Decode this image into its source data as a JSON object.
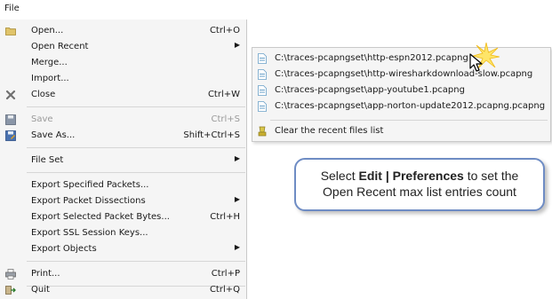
{
  "menubar": {
    "file_title": "File"
  },
  "file_menu": {
    "items": [
      {
        "label": "Open...",
        "shortcut": "Ctrl+O"
      },
      {
        "label": "Open Recent"
      },
      {
        "label": "Merge..."
      },
      {
        "label": "Import..."
      },
      {
        "label": "Close",
        "shortcut": "Ctrl+W"
      },
      {
        "label": "Save",
        "shortcut": "Ctrl+S"
      },
      {
        "label": "Save As...",
        "shortcut": "Shift+Ctrl+S"
      },
      {
        "label": "File Set"
      },
      {
        "label": "Export Specified Packets..."
      },
      {
        "label": "Export Packet Dissections"
      },
      {
        "label": "Export Selected Packet Bytes...",
        "shortcut": "Ctrl+H"
      },
      {
        "label": "Export SSL Session Keys..."
      },
      {
        "label": "Export Objects"
      },
      {
        "label": "Print...",
        "shortcut": "Ctrl+P"
      },
      {
        "label": "Quit",
        "shortcut": "Ctrl+Q"
      }
    ]
  },
  "recent_menu": {
    "files": [
      "C:\\traces-pcapngset\\http-espn2012.pcapng",
      "C:\\traces-pcapngset\\http-wiresharkdownload-slow.pcapng",
      "C:\\traces-pcapngset\\app-youtube1.pcapng",
      "C:\\traces-pcapngset\\app-norton-update2012.pcapng.pcapng"
    ],
    "clear_label": "Clear the recent files list"
  },
  "callout": {
    "prefix": "Select ",
    "bold": "Edit | Preferences",
    "line1_suffix": " to set the",
    "line2": "Open Recent max list entries count"
  },
  "colors": {
    "menu_bg": "#f5f5f5",
    "callout_border": "#6e8cc4",
    "separator": "#d6d6d6"
  }
}
